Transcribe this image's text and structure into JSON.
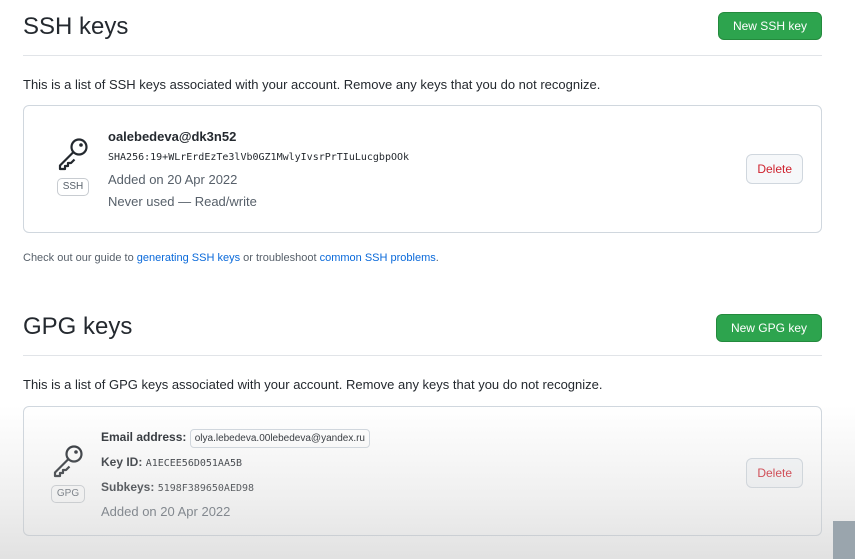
{
  "ssh": {
    "title": "SSH keys",
    "new_button": "New SSH key",
    "description": "This is a list of SSH keys associated with your account. Remove any keys that you do not recognize.",
    "key": {
      "type_label": "SSH",
      "title": "oalebedeva@dk3n52",
      "fingerprint": "SHA256:19+WLrErdEzTe3lVb0GZ1MwlyIvsrPrTIuLucgbpOOk",
      "added": "Added on 20 Apr 2022",
      "usage": "Never used — Read/write",
      "delete_label": "Delete"
    },
    "guide": {
      "prefix": "Check out our guide to ",
      "link1": "generating SSH keys",
      "middle": " or troubleshoot ",
      "link2": "common SSH problems",
      "suffix": "."
    }
  },
  "gpg": {
    "title": "GPG keys",
    "new_button": "New GPG key",
    "description": "This is a list of GPG keys associated with your account. Remove any keys that you do not recognize.",
    "key": {
      "type_label": "GPG",
      "email_label": "Email address:",
      "email": "olya.lebedeva.00lebedeva@yandex.ru",
      "keyid_label": "Key ID:",
      "keyid": "A1ECEE56D051AA5B",
      "subkeys_label": "Subkeys:",
      "subkeys": "5198F389650AED98",
      "added": "Added on 20 Apr 2022",
      "delete_label": "Delete"
    }
  },
  "colors": {
    "primary": "#2da44e",
    "danger": "#cf222e",
    "link": "#0969da"
  },
  "icons": [
    "key-icon"
  ]
}
